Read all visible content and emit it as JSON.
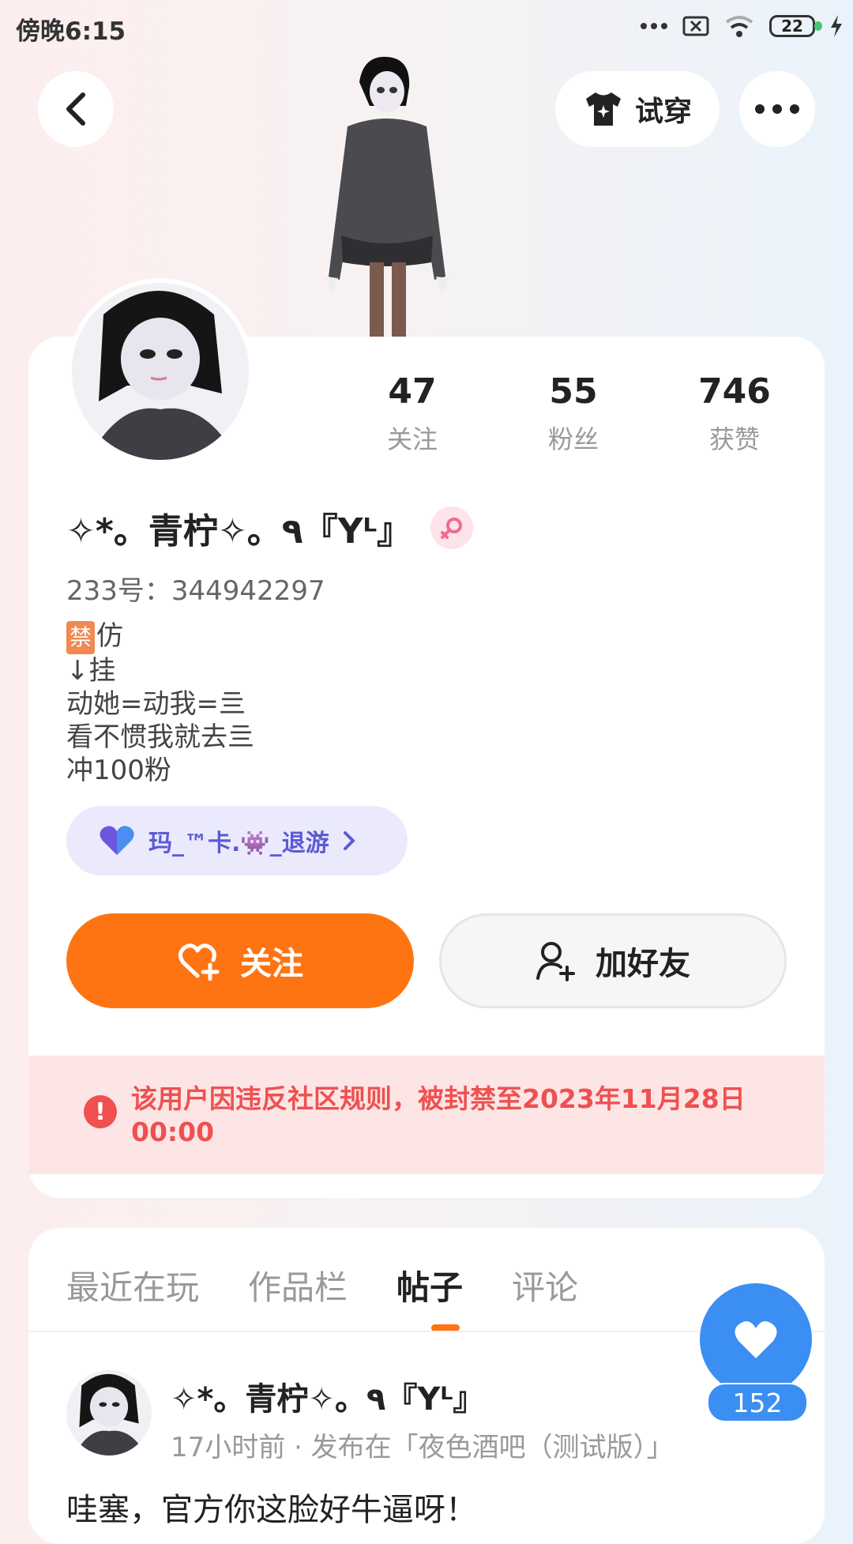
{
  "status_bar": {
    "time": "傍晚6:15",
    "battery": "22"
  },
  "header": {
    "try_on_label": "试穿"
  },
  "stats": [
    {
      "value": "47",
      "label": "关注"
    },
    {
      "value": "55",
      "label": "粉丝"
    },
    {
      "value": "746",
      "label": "获赞"
    }
  ],
  "profile": {
    "username": "✧*。青柠✧。٩『Yᴸ』",
    "uid": "233号：344942297",
    "bio_ban_badge": "禁",
    "bio_line1_rest": "仿",
    "bio_line2": "↓挂",
    "bio_line3": "动她=动我=亖",
    "bio_line4": "看不惯我就去亖",
    "bio_line5": "冲100粉",
    "guild_name": "玛_™卡.👾_退游"
  },
  "actions": {
    "follow_label": "关注",
    "add_friend_label": "加好友"
  },
  "notice": {
    "text": "该用户因违反社区规则，被封禁至2023年11月28日00:00"
  },
  "tabs": [
    {
      "label": "最近在玩"
    },
    {
      "label": "作品栏"
    },
    {
      "label": "帖子"
    },
    {
      "label": "评论"
    }
  ],
  "post": {
    "username": "✧*。青柠✧。٩『Yᴸ』",
    "meta": "17小时前 · 发布在「夜色酒吧（测试版）」",
    "text": "哇塞，官方你这脸好牛逼呀！",
    "like_count": "152"
  },
  "colors": {
    "accent": "#ff7412",
    "notice": "#ef5050",
    "like": "#3b8ef2",
    "guild": "#5b5bd6"
  }
}
